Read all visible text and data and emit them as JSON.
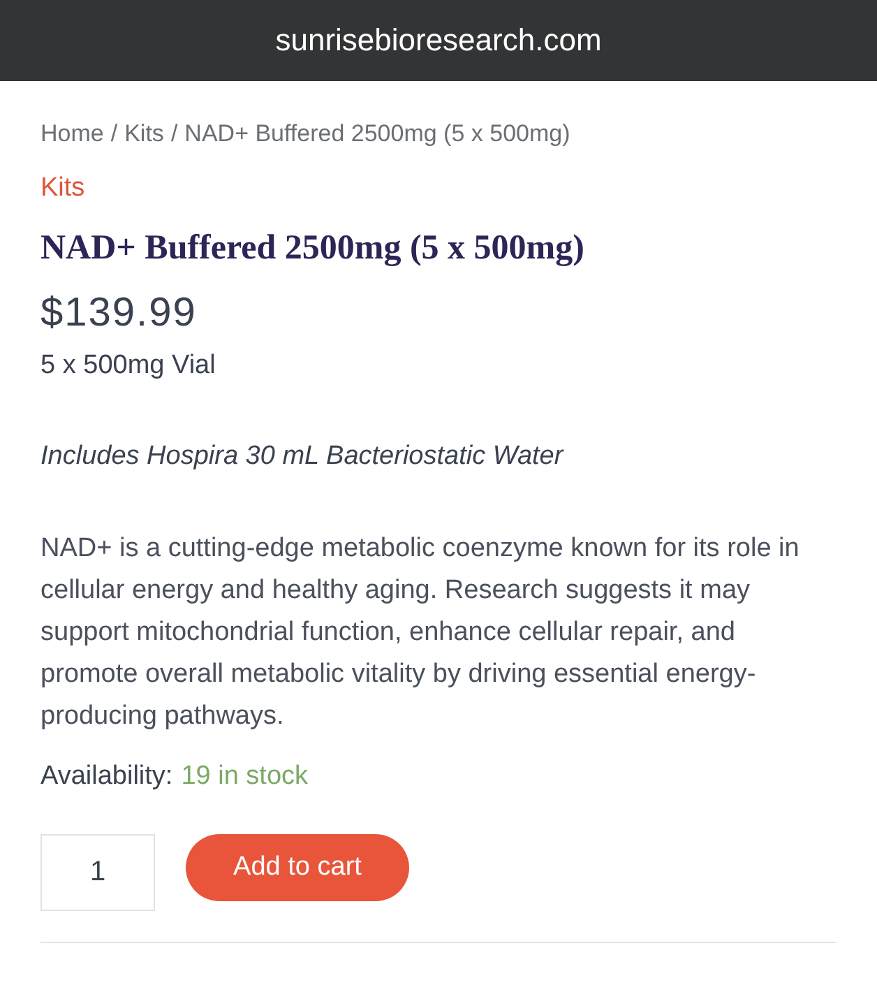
{
  "address_bar": {
    "url": "sunrisebioresearch.com"
  },
  "breadcrumb": {
    "separator": "/",
    "items": [
      {
        "label": "Home"
      },
      {
        "label": "Kits"
      },
      {
        "label": "NAD+ Buffered 2500mg (5 x 500mg)"
      }
    ]
  },
  "category": "Kits",
  "product": {
    "title": "NAD+ Buffered 2500mg (5 x 500mg)",
    "price": "$139.99",
    "variant": "5 x 500mg Vial",
    "note": "Includes Hospira 30 mL Bacteriostatic Water",
    "description": "NAD+ is a cutting-edge metabolic coenzyme known for its role in cellular energy and healthy aging. Research suggests it may support mitochondrial function, enhance cellular repair, and promote overall metabolic vitality by driving essential energy-producing pathways.",
    "availability_label": "Availability:",
    "availability_value": "19 in stock"
  },
  "cart": {
    "quantity": "1",
    "button": "Add to cart"
  }
}
